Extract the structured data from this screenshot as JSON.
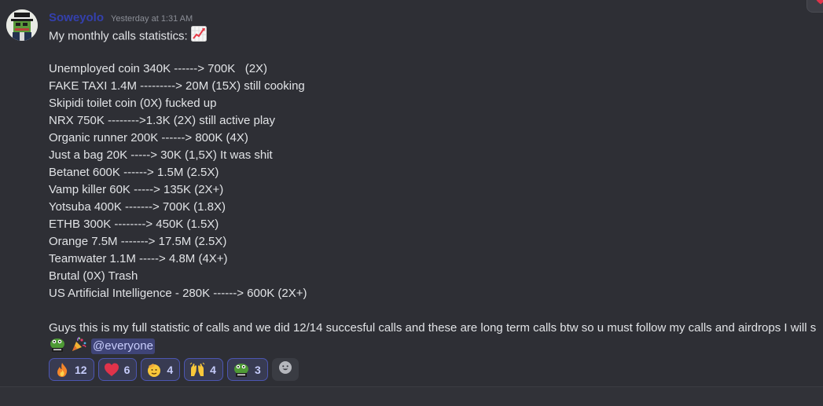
{
  "message": {
    "username": "Soweyolo",
    "timestamp": "Yesterday at 1:31 AM",
    "lines": [
      "My monthly calls statistics: ",
      "",
      "Unemployed coin 340K ------> 700K   (2X)",
      "FAKE TAXI 1.4M ---------> 20M (15X) still cooking",
      "Skipidi toilet coin (0X) fucked up",
      "NRX 750K -------->1.3K (2X) still active play",
      "Organic runner 200K ------> 800K (4X)",
      "Just a bag 20K -----> 30K (1,5X) It was shit",
      "Betanet 600K ------> 1.5M (2.5X)",
      "Vamp killer 60K -----> 135K (2X+)",
      "Yotsuba 400K -------> 700K (1.8X)",
      "ETHB 300K --------> 450K (1.5X)",
      "Orange 7.5M -------> 17.5M (2.5X)",
      "Teamwater 1.1M -----> 4.8M (4X+)",
      "Brutal (0X) Trash",
      "US Artificial Intelligence - 280K ------> 600K (2X+)",
      "",
      "Guys this is my full statistic of calls and we did 12/14 succesful calls and these are long term calls btw so u must follow my calls and airdrops I will s"
    ],
    "title_emoji": "chart-increasing-icon",
    "footer_emojis": [
      "sauce-frog-icon",
      "party-popper-icon"
    ],
    "mention": "@everyone"
  },
  "reactions": [
    {
      "emoji": "fire-icon",
      "count": "12"
    },
    {
      "emoji": "red-heart-icon",
      "count": "6"
    },
    {
      "emoji": "saluting-face-icon",
      "count": "4"
    },
    {
      "emoji": "raising-hands-icon",
      "count": "4"
    },
    {
      "emoji": "sauce-frog-icon",
      "count": "3"
    }
  ],
  "add_reaction": "add-reaction-icon",
  "colors": {
    "background": "#323339",
    "text": "#e1e3e6",
    "username": "#3440ad",
    "reaction_border": "#4c56b2",
    "mention_bg": "#3f4477"
  }
}
